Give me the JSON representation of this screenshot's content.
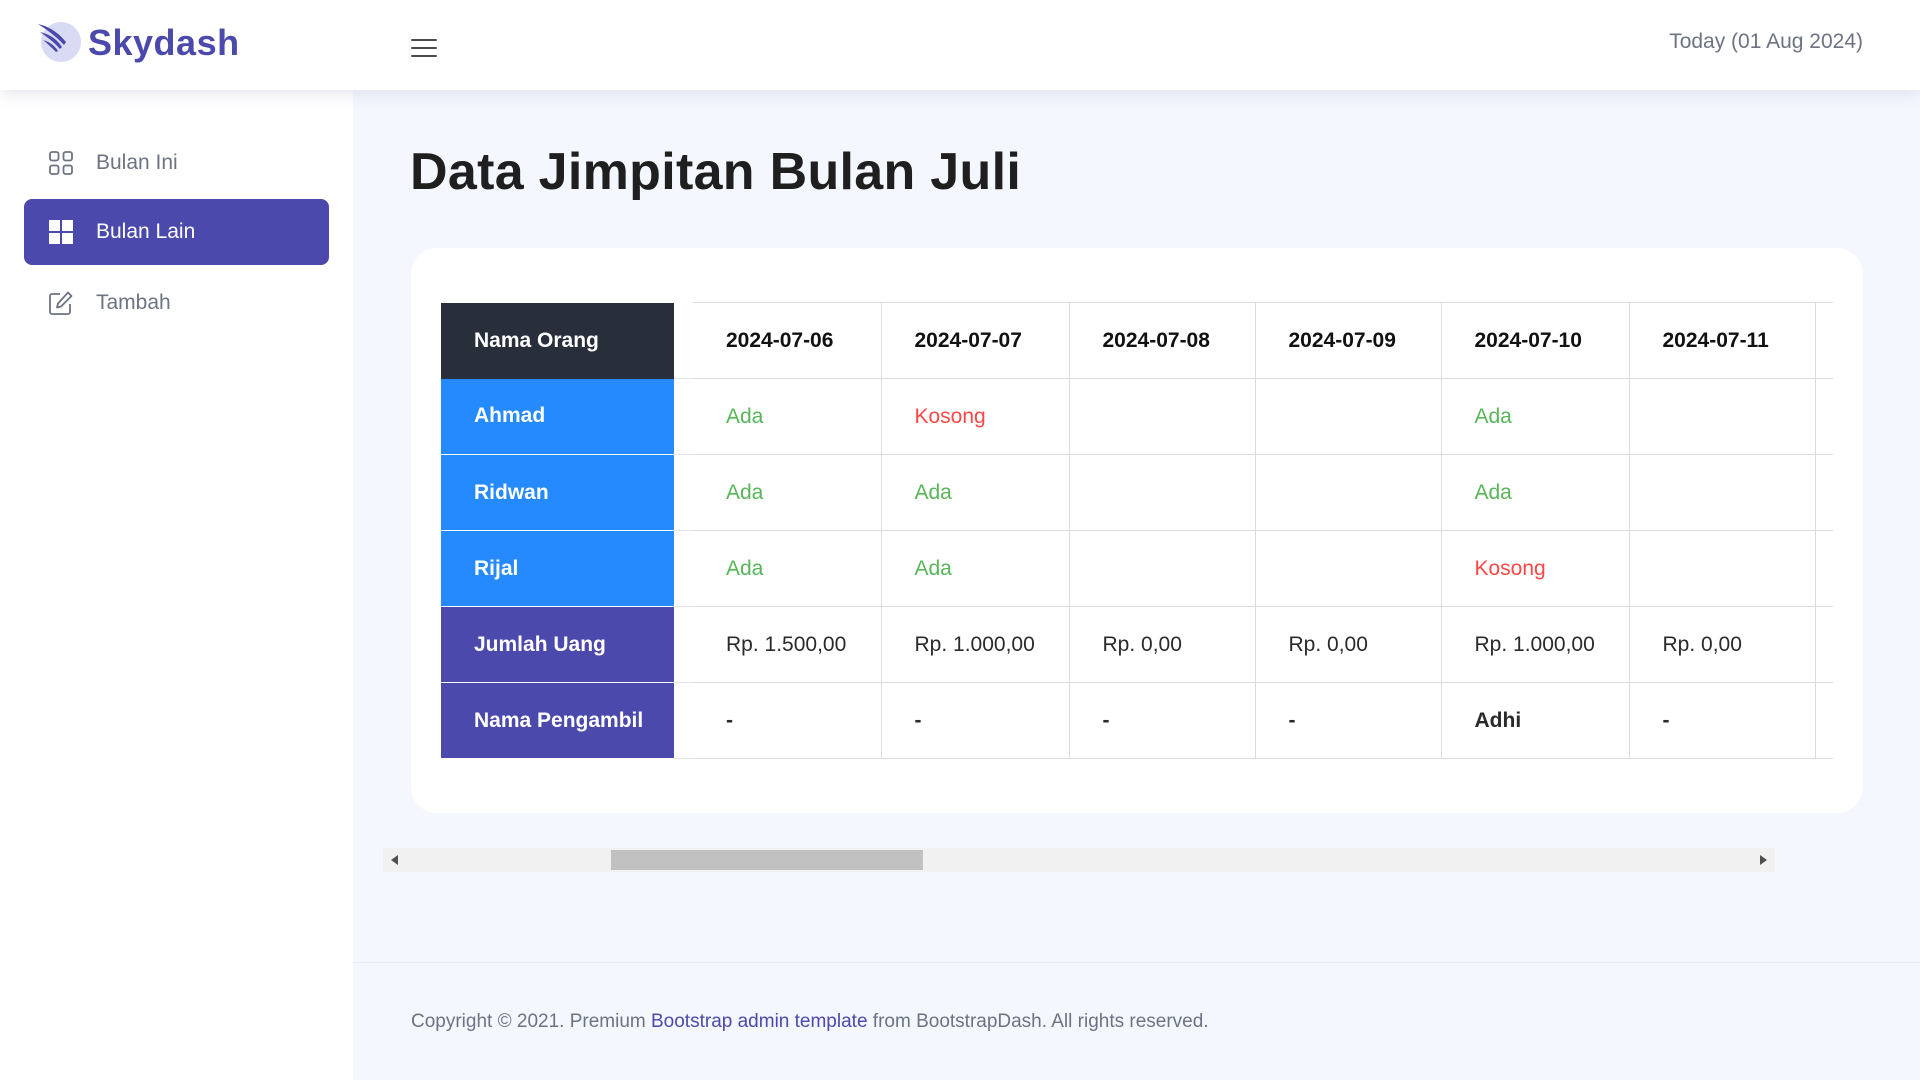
{
  "app": {
    "brand_name": "Skydash",
    "accent_color": "#4b49ac"
  },
  "header": {
    "menu_icon": "hamburger-menu-icon",
    "today_label": "Today (01 Aug 2024)"
  },
  "sidebar": {
    "items": [
      {
        "label": "Bulan Ini",
        "icon": "grid-outline-icon",
        "active": false
      },
      {
        "label": "Bulan Lain",
        "icon": "grid-filled-icon",
        "active": true
      },
      {
        "label": "Tambah",
        "icon": "edit-icon",
        "active": false
      }
    ]
  },
  "main": {
    "title": "Data Jimpitan Bulan Juli",
    "table": {
      "corner_label": "Nama Orang",
      "dates": [
        "2024-07-06",
        "2024-07-07",
        "2024-07-08",
        "2024-07-09",
        "2024-07-10",
        "2024-07-11"
      ],
      "rows": [
        {
          "name": "Ahmad",
          "values": [
            "Ada",
            "Kosong",
            "",
            "",
            "Ada",
            ""
          ]
        },
        {
          "name": "Ridwan",
          "values": [
            "Ada",
            "Ada",
            "",
            "",
            "Ada",
            ""
          ]
        },
        {
          "name": "Rijal",
          "values": [
            "Ada",
            "Ada",
            "",
            "",
            "Kosong",
            ""
          ]
        }
      ],
      "totals_label": "Jumlah Uang",
      "totals": [
        "Rp. 1.500,00",
        "Rp. 1.000,00",
        "Rp. 0,00",
        "Rp. 0,00",
        "Rp. 1.000,00",
        "Rp. 0,00"
      ],
      "collector_label": "Nama Pengambil",
      "collectors": [
        "-",
        "-",
        "-",
        "-",
        "Adhi",
        "-"
      ],
      "status_colors": {
        "Ada": "#57b657",
        "Kosong": "#ff4747"
      }
    }
  },
  "footer": {
    "prefix": "Copyright © 2021. Premium ",
    "link_text": "Bootstrap admin template",
    "suffix": " from BootstrapDash. All rights reserved."
  }
}
